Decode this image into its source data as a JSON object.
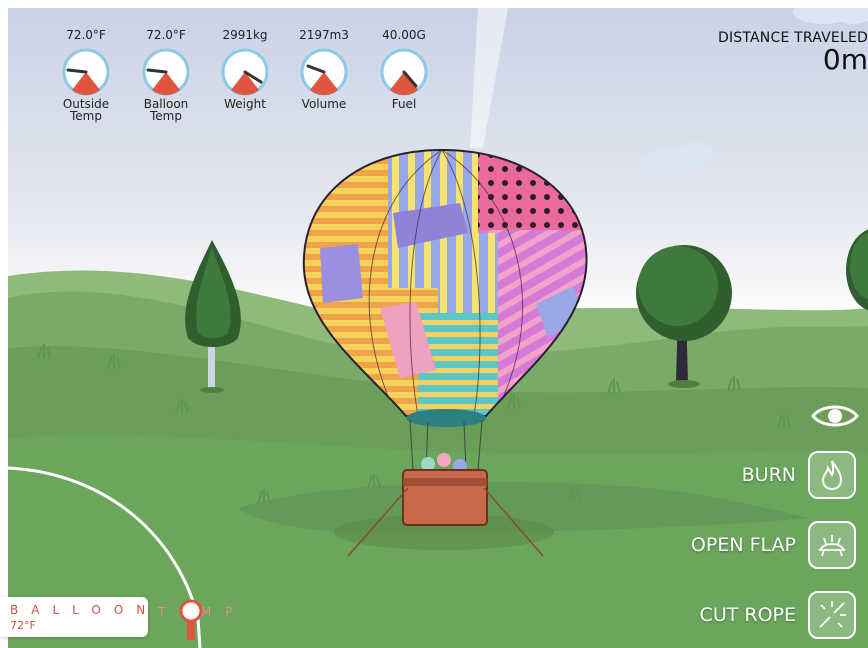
{
  "gauges": [
    {
      "value": "72.0°F",
      "label": "Outside\nTemp",
      "level": 0.12
    },
    {
      "value": "72.0°F",
      "label": "Balloon\nTemp",
      "level": 0.12
    },
    {
      "value": "2991kg",
      "label": "Weight",
      "level": 0.7
    },
    {
      "value": "2197m3",
      "label": "Volume",
      "level": 0.18
    },
    {
      "value": "40.00G",
      "label": "Fuel",
      "level": 0.62
    }
  ],
  "distance": {
    "label": "DISTANCE TRAVELED",
    "value": "0m"
  },
  "actions": {
    "burn": "BURN",
    "open_flap": "OPEN FLAP",
    "cut_rope": "CUT ROPE"
  },
  "temp_control": {
    "name": "BALLOON",
    "tail": "TEMP",
    "value": "72°F",
    "level": 0.12
  },
  "icons": {
    "visibility": "eye-icon",
    "burn": "flame-icon",
    "open_flap": "flap-icon",
    "cut_rope": "scissors-icon"
  },
  "colors": {
    "accent": "#e0553f",
    "grass": "#6fa35d",
    "sky": "#c9d2e6"
  }
}
